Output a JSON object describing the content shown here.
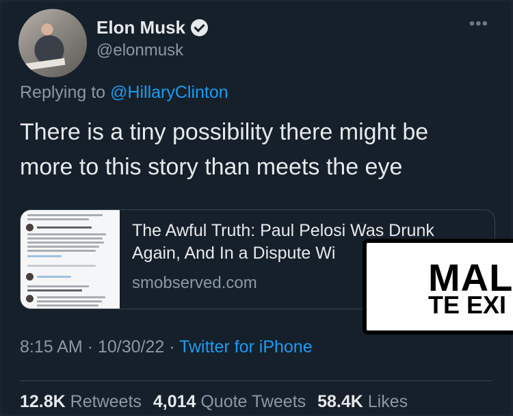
{
  "author": {
    "name": "Elon Musk",
    "handle": "@elonmusk"
  },
  "reply": {
    "prefix": "Replying to",
    "to": "@HillaryClinton"
  },
  "tweet": {
    "line1": "There is a tiny possibility there might be",
    "line2": "more to this story than meets the eye"
  },
  "card": {
    "title_line1": "The Awful Truth: Paul Pelosi Was Drunk",
    "title_line2": "Again, And In a Dispute Wi",
    "domain": "smobserved.com"
  },
  "overlay": {
    "line1": "MALI",
    "line2": "TE EXI"
  },
  "meta": {
    "time": "8:15 AM",
    "date": "10/30/22",
    "source": "Twitter for iPhone"
  },
  "stats": {
    "retweets_count": "12.8K",
    "retweets_label": "Retweets",
    "quotes_count": "4,014",
    "quotes_label": "Quote Tweets",
    "likes_count": "58.4K",
    "likes_label": "Likes"
  },
  "icons": {
    "verified": "verified-badge-icon",
    "more": "more-options-icon"
  },
  "colors": {
    "background": "#15202b",
    "link": "#1d9bf0",
    "muted": "#8b98a5",
    "text": "#e7e9ea"
  }
}
